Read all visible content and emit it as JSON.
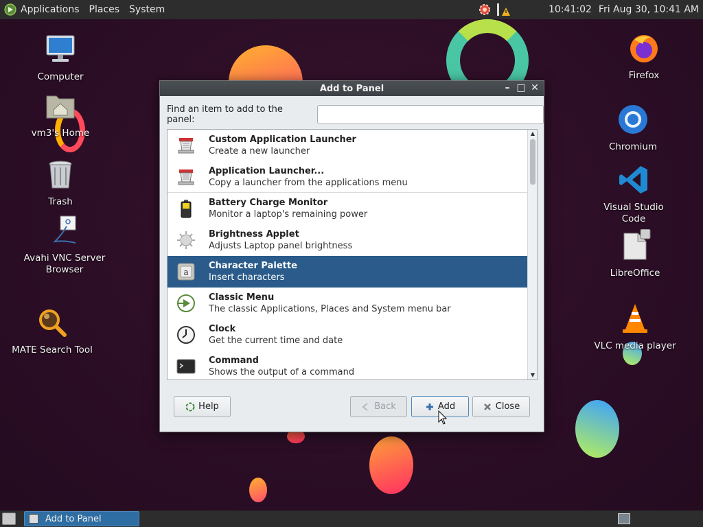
{
  "top_panel": {
    "menus": [
      "Applications",
      "Places",
      "System"
    ],
    "time": "10:41:02",
    "date": "Fri Aug 30, 10:41 AM"
  },
  "desktop_icons_left": [
    {
      "label": "Computer",
      "icon": "computer-icon"
    },
    {
      "label": "vm3's Home",
      "icon": "home-folder-icon"
    },
    {
      "label": "Trash",
      "icon": "trash-icon"
    },
    {
      "label": "Avahi VNC Server Browser",
      "icon": "network-icon"
    },
    {
      "label": "MATE Search Tool",
      "icon": "search-tool-icon"
    }
  ],
  "desktop_icons_right": [
    {
      "label": "Firefox",
      "icon": "firefox-icon"
    },
    {
      "label": "Chromium",
      "icon": "chromium-icon"
    },
    {
      "label": "Visual Studio Code",
      "icon": "vscode-icon"
    },
    {
      "label": "LibreOffice",
      "icon": "libreoffice-icon"
    },
    {
      "label": "VLC media player",
      "icon": "vlc-icon"
    }
  ],
  "dialog": {
    "title": "Add to Panel",
    "find_label": "Find an item to add to the panel:",
    "find_value": "",
    "items": [
      {
        "name": "Custom Application Launcher",
        "desc": "Create a new launcher",
        "icon": "launcher-icon"
      },
      {
        "name": "Application Launcher...",
        "desc": "Copy a launcher from the applications menu",
        "icon": "launcher-icon"
      },
      {
        "name": "Battery Charge Monitor",
        "desc": "Monitor a laptop's remaining power",
        "icon": "battery-icon"
      },
      {
        "name": "Brightness Applet",
        "desc": "Adjusts Laptop panel brightness",
        "icon": "brightness-icon"
      },
      {
        "name": "Character Palette",
        "desc": "Insert characters",
        "icon": "character-palette-icon",
        "selected": true
      },
      {
        "name": "Classic Menu",
        "desc": "The classic Applications, Places and System menu bar",
        "icon": "classic-menu-icon"
      },
      {
        "name": "Clock",
        "desc": "Get the current time and date",
        "icon": "clock-icon"
      },
      {
        "name": "Command",
        "desc": "Shows the output of a command",
        "icon": "terminal-icon"
      }
    ],
    "buttons": {
      "help": "Help",
      "back": "Back",
      "add": "Add",
      "close": "Close"
    }
  },
  "taskbar": {
    "window_label": "Add to Panel"
  },
  "colors": {
    "selection": "#2a5b8a",
    "panel": "#2d2d2d",
    "taskbar_active": "#2f6ea3"
  }
}
